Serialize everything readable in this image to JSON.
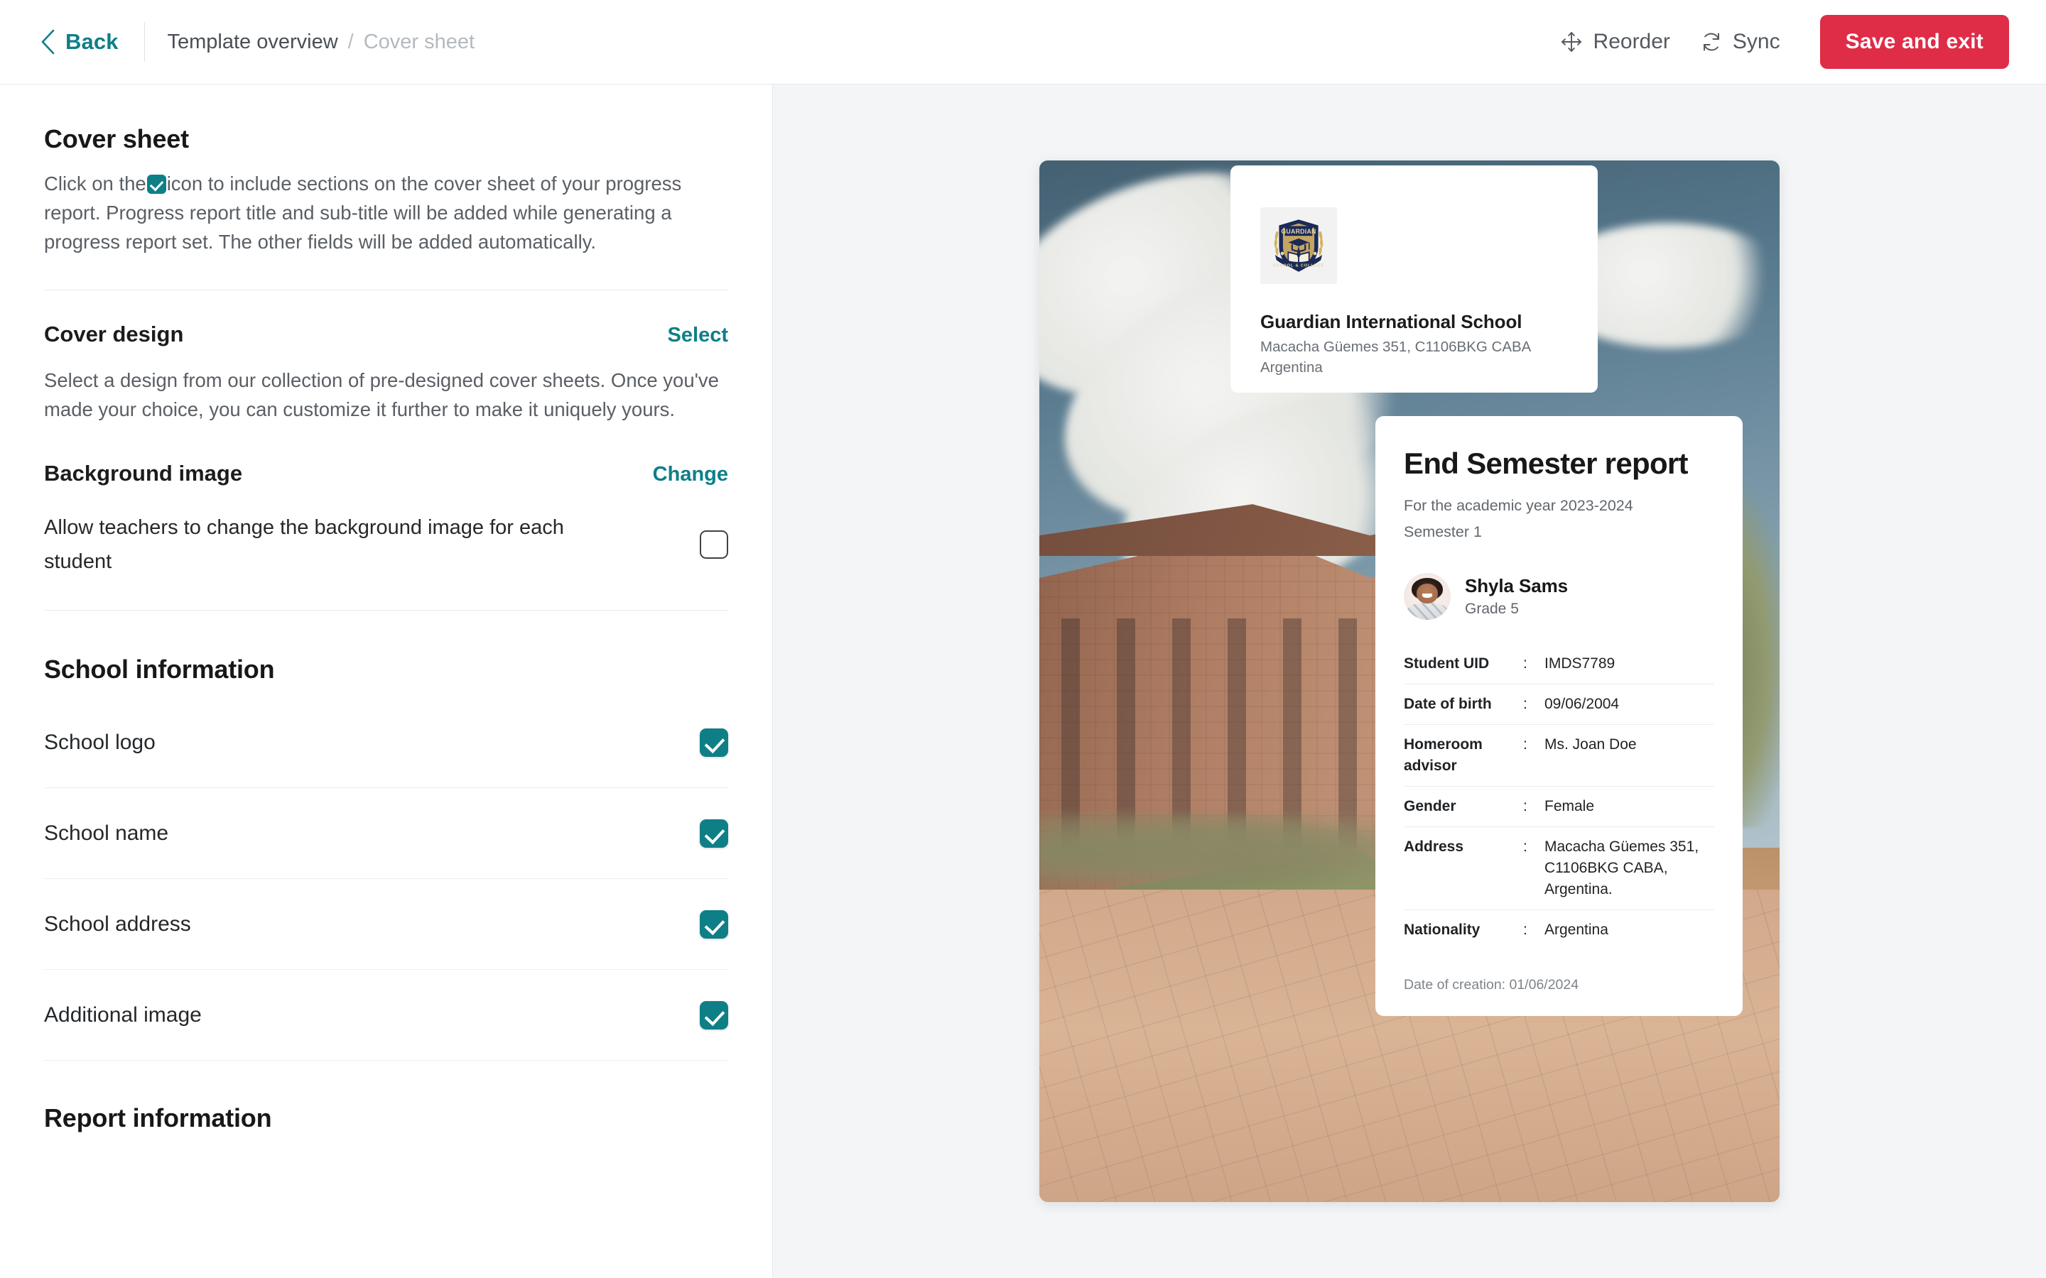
{
  "topbar": {
    "back_label": "Back",
    "breadcrumb": {
      "parent": "Template overview",
      "separator": "/",
      "current": "Cover sheet"
    },
    "reorder_label": "Reorder",
    "sync_label": "Sync",
    "save_label": "Save and exit",
    "save_color": "#df2c47",
    "accent_color": "#0e7f87"
  },
  "left_panel": {
    "title": "Cover sheet",
    "intro_part1": "Click on the",
    "intro_part2": "icon to include sections on the cover sheet of your progress report. Progress report title and sub-title will be added while generating a progress report set. The other fields will be added automatically.",
    "cover_design": {
      "heading": "Cover design",
      "action_label": "Select",
      "description": "Select a design from our collection of pre-designed cover sheets. Once you've made your choice, you can customize it further to make it uniquely yours."
    },
    "background_image": {
      "heading": "Background image",
      "action_label": "Change",
      "toggle_label": "Allow teachers to change the background image for each student",
      "toggle_checked": false
    },
    "school_information": {
      "heading": "School information",
      "options": [
        {
          "label": "School logo",
          "checked": true
        },
        {
          "label": "School name",
          "checked": true
        },
        {
          "label": "School address",
          "checked": true
        },
        {
          "label": "Additional image",
          "checked": true
        }
      ]
    },
    "report_information": {
      "heading": "Report information"
    }
  },
  "preview": {
    "school": {
      "name": "Guardian International School",
      "address": "Macacha Güemes 351, C1106BKG CABA Argentina",
      "logo_text_top": "GUARDIAN",
      "logo_text_bottom": "SCHOOL & COLLEGE"
    },
    "report": {
      "title": "End Semester report",
      "academic_year_line": "For the academic year 2023-2024",
      "semester_line": "Semester 1",
      "student_name": "Shyla Sams",
      "student_grade": "Grade 5",
      "details": [
        {
          "key": "Student UID",
          "sep": ":",
          "value": "IMDS7789"
        },
        {
          "key": "Date of birth",
          "sep": ":",
          "value": "09/06/2004"
        },
        {
          "key": "Homeroom advisor",
          "sep": ":",
          "value": "Ms. Joan Doe"
        },
        {
          "key": "Gender",
          "sep": ":",
          "value": "Female"
        },
        {
          "key": "Address",
          "sep": ":",
          "value": "Macacha Güemes 351, C1106BKG CABA, Argentina."
        },
        {
          "key": "Nationality",
          "sep": ":",
          "value": "Argentina"
        }
      ],
      "creation_line": "Date of creation: 01/06/2024"
    }
  }
}
